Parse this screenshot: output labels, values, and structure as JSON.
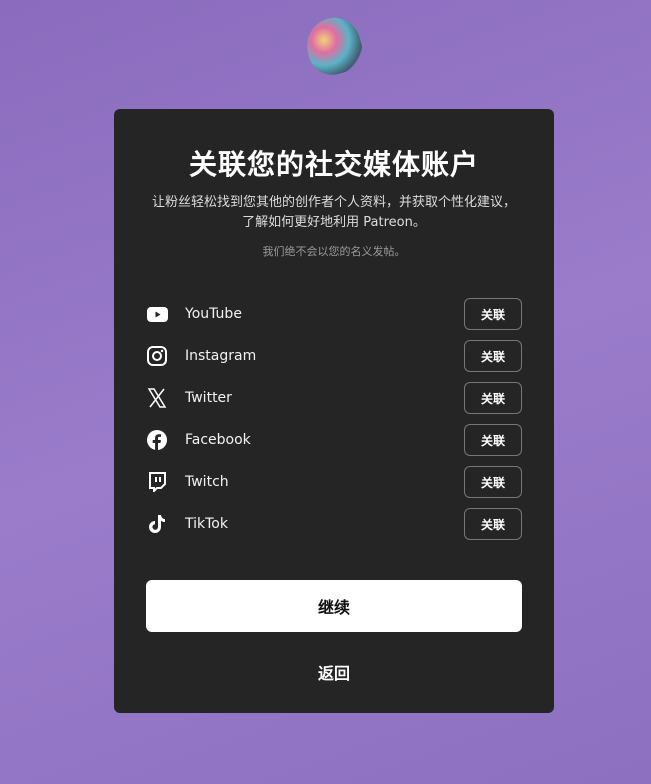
{
  "title": "关联您的社交媒体账户",
  "subtitle": "让粉丝轻松找到您其他的创作者个人资料，并获取个性化建议，了解如何更好地利用 Patreon。",
  "note": "我们绝不会以您的名义发帖。",
  "accounts": [
    {
      "name": "YouTube",
      "icon": "youtube-icon",
      "action": "关联"
    },
    {
      "name": "Instagram",
      "icon": "instagram-icon",
      "action": "关联"
    },
    {
      "name": "Twitter",
      "icon": "x-icon",
      "action": "关联"
    },
    {
      "name": "Facebook",
      "icon": "facebook-icon",
      "action": "关联"
    },
    {
      "name": "Twitch",
      "icon": "twitch-icon",
      "action": "关联"
    },
    {
      "name": "TikTok",
      "icon": "tiktok-icon",
      "action": "关联"
    }
  ],
  "continue_label": "继续",
  "back_label": "返回"
}
